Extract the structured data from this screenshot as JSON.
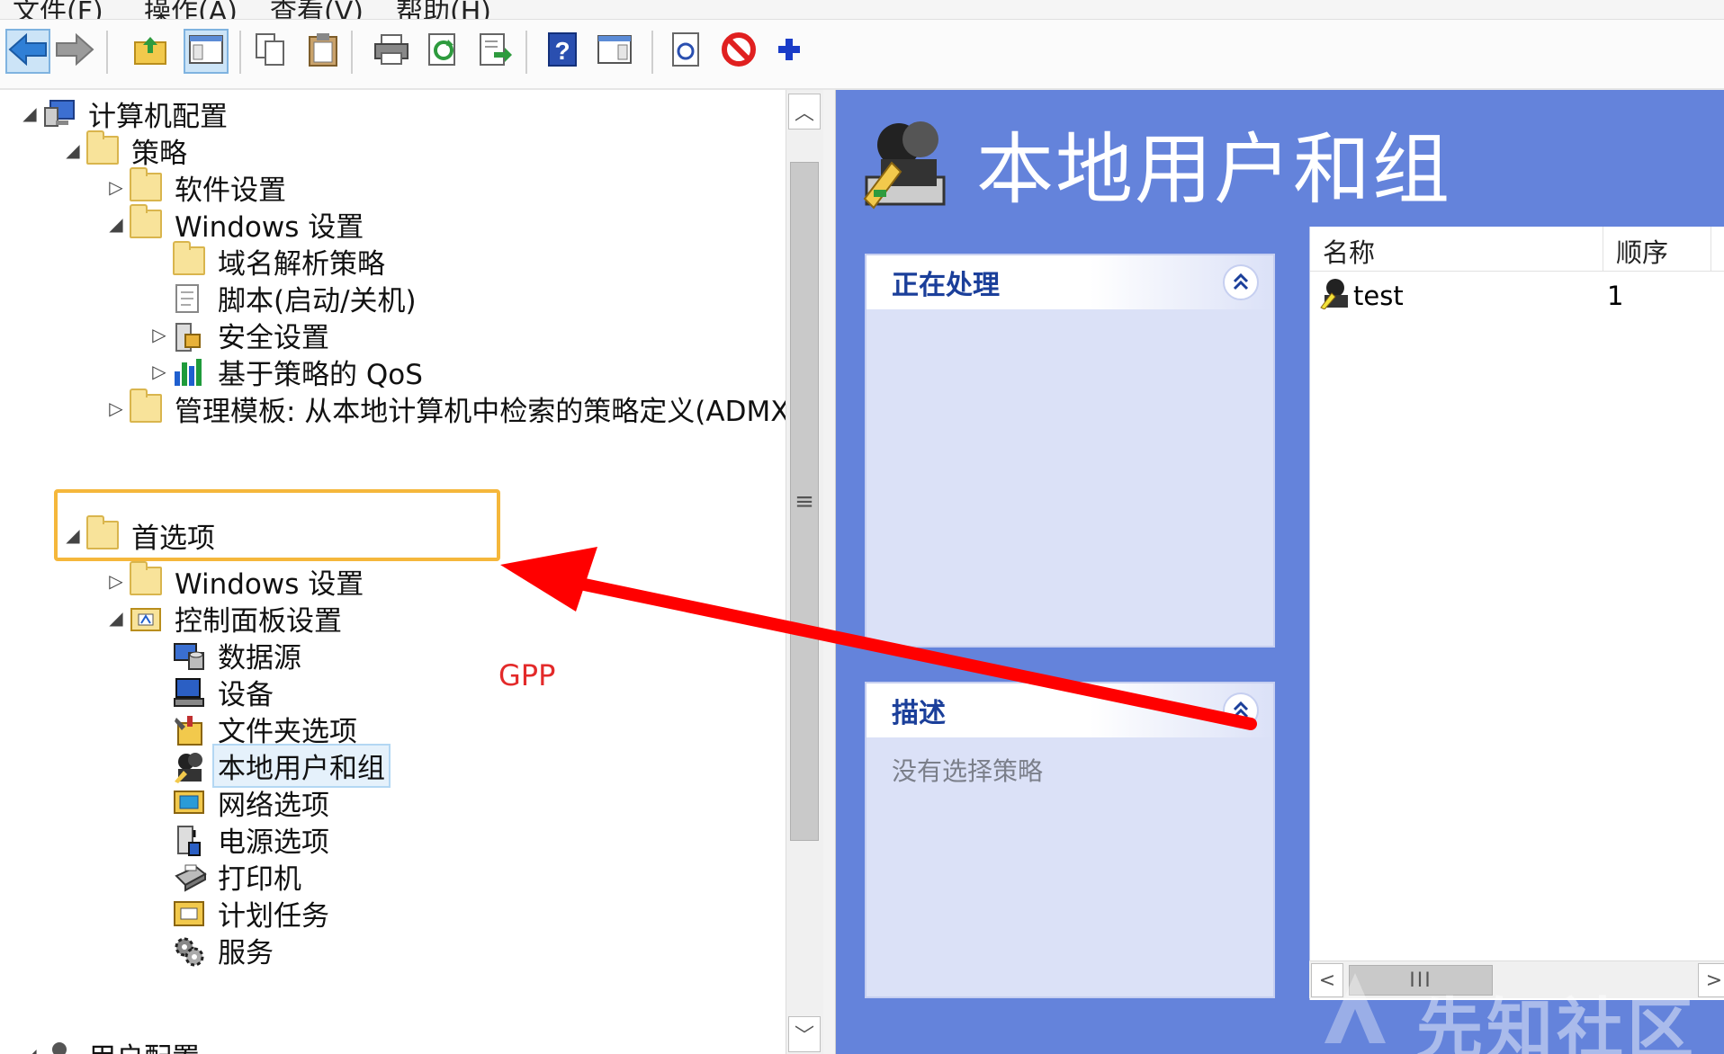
{
  "menubar": {
    "items": [
      "文件(F)",
      "操作(A)",
      "查看(V)",
      "帮助(H)"
    ]
  },
  "toolbar": {
    "buttons": [
      {
        "name": "back",
        "icon": "back-arrow-icon"
      },
      {
        "name": "forward",
        "icon": "forward-arrow-icon"
      },
      {
        "name": "up",
        "icon": "folder-up-icon"
      },
      {
        "name": "show-hide-tree",
        "icon": "console-tree-icon"
      },
      {
        "name": "copy",
        "icon": "copy-icon"
      },
      {
        "name": "paste",
        "icon": "paste-icon"
      },
      {
        "name": "print",
        "icon": "print-icon"
      },
      {
        "name": "refresh",
        "icon": "refresh-icon"
      },
      {
        "name": "export",
        "icon": "export-list-icon"
      },
      {
        "name": "help",
        "icon": "help-icon"
      },
      {
        "name": "action-pane",
        "icon": "action-pane-icon"
      },
      {
        "name": "properties",
        "icon": "properties-icon"
      },
      {
        "name": "stop",
        "icon": "stop-icon"
      },
      {
        "name": "add",
        "icon": "plus-icon"
      }
    ]
  },
  "tree": {
    "nodes": [
      {
        "label": "计算机配置",
        "expander": "◢",
        "icon": "computer-icon"
      },
      {
        "label": "策略",
        "expander": "◢",
        "icon": "folder-icon"
      },
      {
        "label": "软件设置",
        "expander": "▷",
        "icon": "folder-icon"
      },
      {
        "label": "Windows 设置",
        "expander": "◢",
        "icon": "folder-icon"
      },
      {
        "label": "域名解析策略",
        "expander": "",
        "icon": "folder-icon"
      },
      {
        "label": "脚本(启动/关机)",
        "expander": "",
        "icon": "script-icon"
      },
      {
        "label": "安全设置",
        "expander": "▷",
        "icon": "security-icon"
      },
      {
        "label": "基于策略的 QoS",
        "expander": "▷",
        "icon": "qos-chart-icon"
      },
      {
        "label": "管理模板: 从本地计算机中检索的策略定义(ADMX",
        "expander": "▷",
        "icon": "folder-icon"
      },
      {
        "label": "首选项",
        "expander": "◢",
        "icon": "folder-icon"
      },
      {
        "label": "Windows 设置",
        "expander": "▷",
        "icon": "folder-icon"
      },
      {
        "label": "控制面板设置",
        "expander": "◢",
        "icon": "control-panel-icon"
      },
      {
        "label": "数据源",
        "expander": "",
        "icon": "data-source-icon"
      },
      {
        "label": "设备",
        "expander": "",
        "icon": "device-icon"
      },
      {
        "label": "文件夹选项",
        "expander": "",
        "icon": "folder-options-icon"
      },
      {
        "label": "本地用户和组",
        "expander": "",
        "icon": "users-groups-icon"
      },
      {
        "label": "网络选项",
        "expander": "",
        "icon": "network-icon"
      },
      {
        "label": "电源选项",
        "expander": "",
        "icon": "power-icon"
      },
      {
        "label": "打印机",
        "expander": "",
        "icon": "printer-icon"
      },
      {
        "label": "计划任务",
        "expander": "",
        "icon": "scheduled-task-icon"
      },
      {
        "label": "服务",
        "expander": "",
        "icon": "services-gear-icon"
      },
      {
        "label": "用户配置",
        "expander": "◢",
        "icon": "user-config-icon"
      }
    ],
    "selected": "本地用户和组"
  },
  "right": {
    "title": "本地用户和组",
    "processing_panel": {
      "title": "正在处理",
      "collapse_glyph": "⌃"
    },
    "description_panel": {
      "title": "描述",
      "body": "没有选择策略",
      "collapse_glyph": "⌃"
    },
    "list": {
      "columns": [
        "名称",
        "顺序"
      ],
      "rows": [
        {
          "name": "test",
          "order": "1"
        }
      ]
    },
    "hscroll": {
      "left": "<",
      "thumb": "III",
      "right": ">"
    },
    "background_color": "#6483db"
  },
  "annotation": {
    "label": "GPP",
    "highlight_color": "#f5b73b",
    "arrow_color": "#ff0000"
  },
  "watermark": {
    "text": "先知社区"
  }
}
